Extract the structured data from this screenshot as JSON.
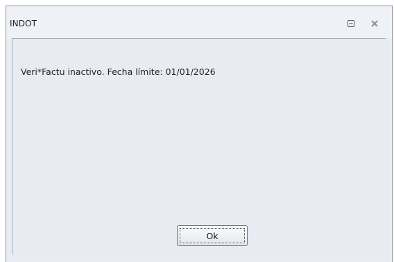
{
  "window": {
    "title": "INDOT",
    "controls": {
      "restore_icon": "restore-icon",
      "close_icon": "close-icon"
    }
  },
  "dialog": {
    "message": "Veri*Factu inactivo. Fecha límite: 01/01/2026",
    "ok_label": "Ok"
  },
  "colors": {
    "background": "#e8ecf2",
    "border": "#8b8f95"
  }
}
